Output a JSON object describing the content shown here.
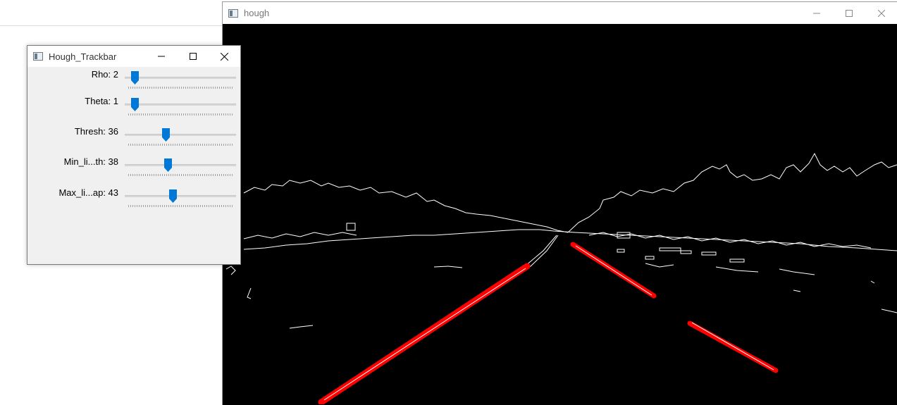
{
  "background_window": {},
  "hough_window": {
    "title": "hough",
    "canvas_background": "#000000",
    "edge_color": "#ffffff",
    "detected_line_color": "#ff0000"
  },
  "trackbar_window": {
    "title": "Hough_Trackbar",
    "accent": "#0078d7",
    "trackbars": [
      {
        "label": "Rho: 2",
        "level": 0.05
      },
      {
        "label": "Theta: 1",
        "level": 0.05
      },
      {
        "label": "Thresh: 36",
        "level": 0.36
      },
      {
        "label": "Min_li...th: 38",
        "level": 0.38
      },
      {
        "label": "Max_li...ap: 43",
        "level": 0.43
      }
    ]
  },
  "icons": {
    "minimize": "minimize-icon",
    "maximize": "maximize-icon",
    "close": "close-icon",
    "app": "window-app-icon"
  }
}
